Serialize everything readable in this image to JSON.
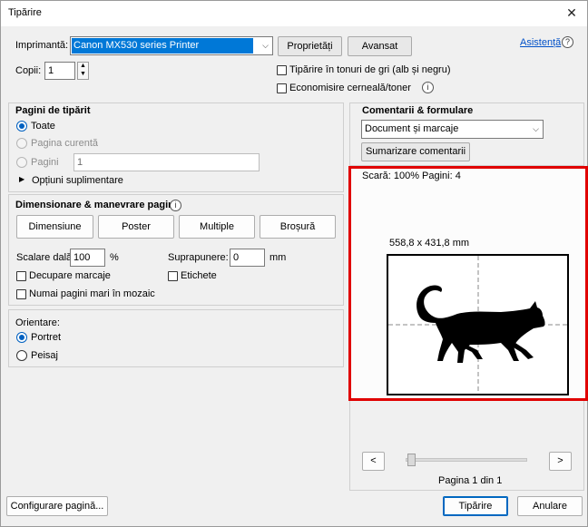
{
  "window": {
    "title": "Tipărire",
    "close_icon": "close-icon"
  },
  "printer": {
    "label": "Imprimantă:",
    "selected": "Canon MX530 series Printer",
    "properties_button": "Proprietăți",
    "advanced_button": "Avansat",
    "help_link": "Asistență"
  },
  "copies": {
    "label": "Copii:",
    "value": "1"
  },
  "options": {
    "grayscale": "Tipărire în tonuri de gri (alb și negru)",
    "save_ink": "Economisire cerneală/toner"
  },
  "pages": {
    "title": "Pagini de tipărit",
    "all": "Toate",
    "current": "Pagina curentă",
    "pages_label": "Pagini",
    "pages_value": "1",
    "more_options": "Opțiuni suplimentare"
  },
  "sizing": {
    "title": "Dimensionare & manevrare pagină",
    "buttons": [
      "Dimensiune",
      "Poster",
      "Multiple",
      "Broșură"
    ],
    "tile_scale_label": "Scalare dală:",
    "tile_scale_value": "100",
    "tile_scale_unit": "%",
    "overlap_label": "Suprapunere:",
    "overlap_value": "0",
    "overlap_unit": "mm",
    "cut_marks": "Decupare marcaje",
    "labels": "Etichete",
    "large_pages_only": "Numai pagini mari în mozaic"
  },
  "orientation": {
    "title": "Orientare:",
    "portrait": "Portret",
    "landscape": "Peisaj"
  },
  "comments": {
    "title": "Comentarii & formulare",
    "selected": "Document și marcaje",
    "summarize_button": "Sumarizare comentarii"
  },
  "preview": {
    "scale_text": "Scară: 100% Pagini: 4",
    "size_text": "558,8 x 431,8 mm",
    "page_text": "Pagina 1 din 1",
    "prev": "<",
    "next": ">"
  },
  "footer": {
    "page_setup": "Configurare pagină...",
    "print": "Tipărire",
    "cancel": "Anulare"
  }
}
